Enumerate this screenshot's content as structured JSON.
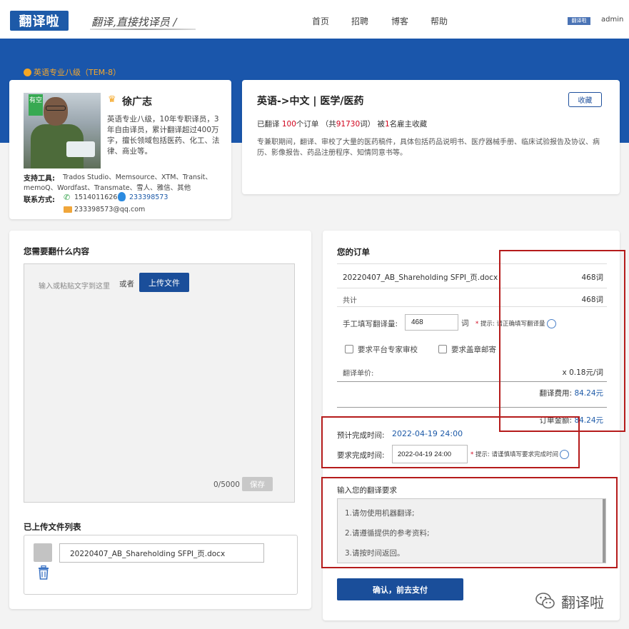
{
  "nav": {
    "logo_text": "翻译啦",
    "slogan": "翻译,直接找译员 /",
    "links": [
      "首页",
      "招聘",
      "博客",
      "帮助"
    ],
    "user_badge": "翻译啦",
    "username": "admin"
  },
  "translator": {
    "level_badge": "英语专业八级（TEM-8）",
    "availability_tag": "有空",
    "name": "徐广志",
    "bio": "英语专业八级，10年专职译员，3年自由译员，累计翻译超过400万字，擅长领域包括医药、化工、法律、商业等。",
    "tools_label": "支持工具:",
    "tools": "Trados Studio、Memsource、XTM、Transit、memoQ、Wordfast、Transmate、雪人、雅信、其他",
    "contact_label": "联系方式:",
    "phone": "15140116268",
    "qq": "233398573",
    "email": "233398573@qq.com"
  },
  "summary": {
    "language_pair": "英语->中文 | 医学/医药",
    "favorite_label": "收藏",
    "stats_prefix": "已翻译 ",
    "orders": "100",
    "stats_mid1": "个订单 （共",
    "words": "91730",
    "stats_mid2": "词） 被",
    "favorites": "1",
    "stats_suffix": "名雇主收藏",
    "description": "专兼职期间，翻译、审校了大量的医药稿件，具体包括药品说明书、医疗器械手册、临床试验报告及协议、病历、影像报告、药品注册程序、知情同意书等。"
  },
  "content": {
    "title": "您需要翻什么内容",
    "placeholder": "输入或粘贴文字到这里",
    "or_text": "或者",
    "upload_label": "上传文件",
    "char_count": "0/5000",
    "save_label": "保存",
    "files_title": "已上传文件列表",
    "files": [
      "20220407_AB_Shareholding SFPI_页.docx"
    ]
  },
  "order": {
    "title": "您的订单",
    "file_name": "20220407_AB_Shareholding SFPI_页.docx",
    "file_words": "468词",
    "total_label": "共计",
    "total_words": "468词",
    "manual_label": "手工填写翻译量:",
    "manual_value": "468",
    "manual_unit": "词",
    "manual_hint_star": "*",
    "manual_hint": " 提示: 请正确填写翻译量",
    "expert_review_label": "要求平台专家审校",
    "seal_mail_label": "要求盖章邮寄",
    "unit_price_label": "翻译单价:",
    "unit_price": "x 0.18元/词",
    "fee_label": "翻译费用: ",
    "fee_value": "84.24元",
    "amount_label": "订单金额: ",
    "amount_value": "84.24元",
    "est_label": "预计完成时间:",
    "est_value": "2022-04-19 24:00",
    "req_label": "要求完成时间:",
    "req_value": "2022-04-19 24:00",
    "req_hint_star": "*",
    "req_hint": " 提示: 请谨慎填写要求完成时间",
    "requirements_title": "输入您的翻译要求",
    "requirements": [
      "1.请勿使用机器翻译;",
      "2.请遵循提供的参考资料;",
      "3.请按时间返回。"
    ],
    "pay_label": "确认，前去支付"
  },
  "watermark": "翻译啦",
  "colors": {
    "brand_blue": "#1a56ab",
    "button_blue": "#1a4e9a",
    "badge_orange": "#f7a82a",
    "accent_red": "#d0021b",
    "annotation_red": "#b51b1b"
  }
}
